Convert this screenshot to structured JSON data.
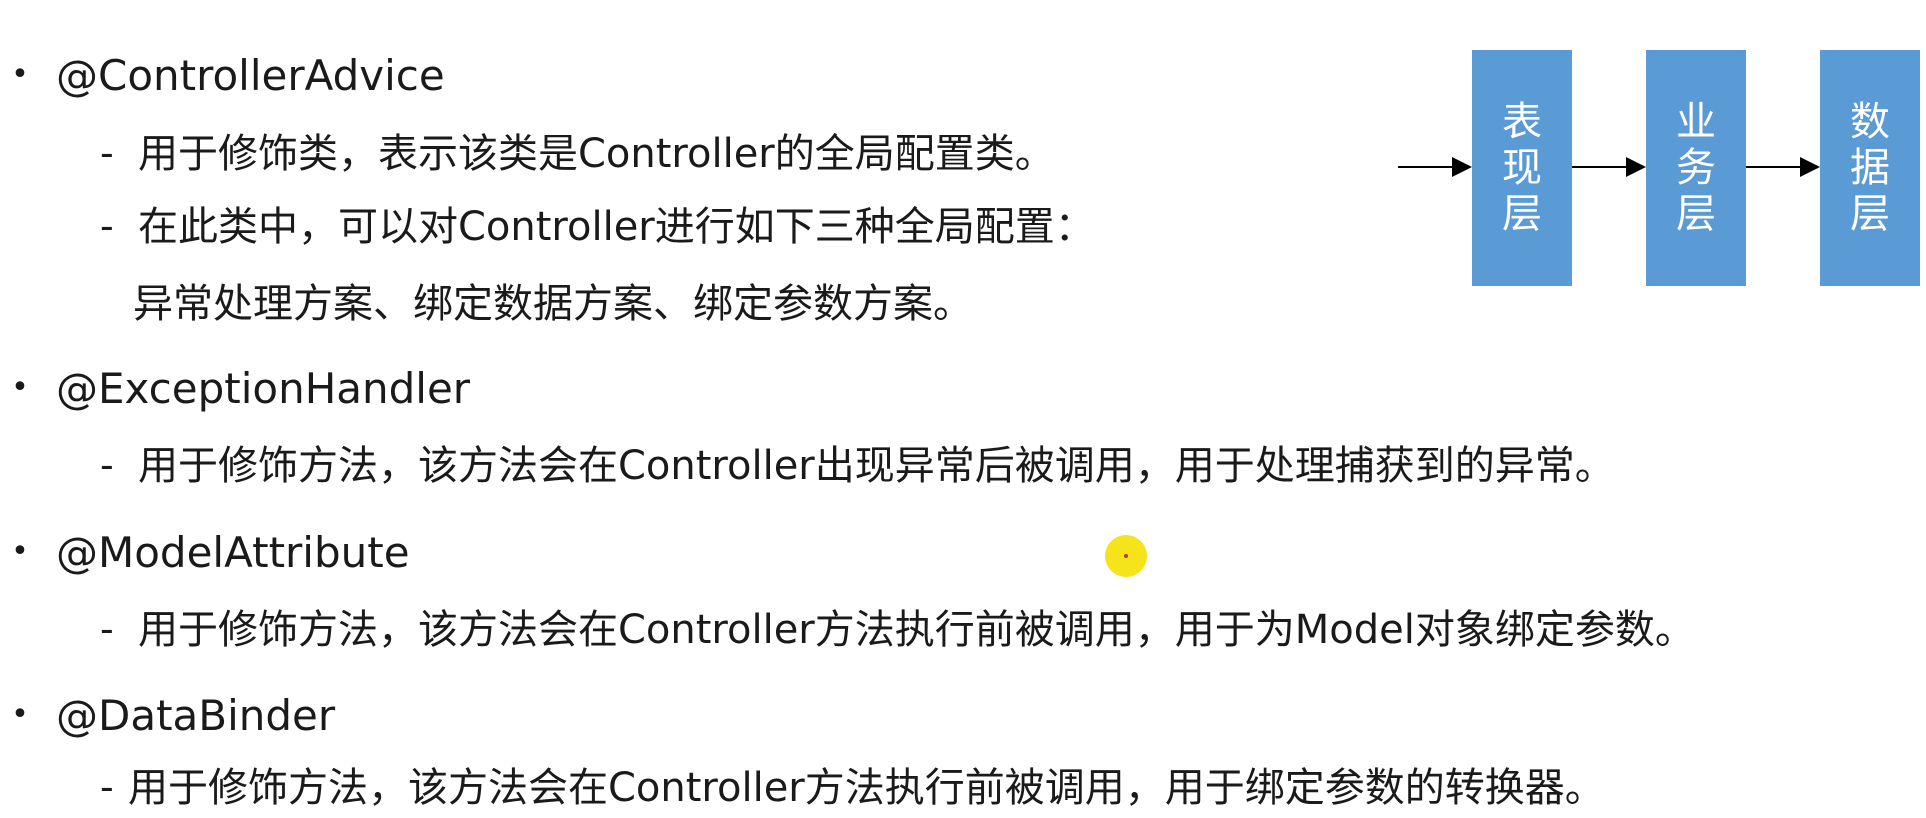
{
  "sections": [
    {
      "heading": "@ControllerAdvice",
      "lines": [
        "用于修饰类，表示该类是Controller的全局配置类。",
        "在此类中，可以对Controller进行如下三种全局配置："
      ],
      "continuation": "异常处理方案、绑定数据方案、绑定参数方案。"
    },
    {
      "heading": "@ExceptionHandler",
      "lines": [
        "用于修饰方法，该方法会在Controller出现异常后被调用，用于处理捕获到的异常。"
      ]
    },
    {
      "heading": "@ModelAttribute",
      "lines": [
        "用于修饰方法，该方法会在Controller方法执行前被调用，用于为Model对象绑定参数。"
      ]
    },
    {
      "heading": "@DataBinder",
      "lines": [
        "用于修饰方法，该方法会在Controller方法执行前被调用，用于绑定参数的转换器。"
      ]
    }
  ],
  "bullet_symbol": "•",
  "dash_symbol": "-",
  "diagram": {
    "boxes": [
      {
        "chars": [
          "表",
          "现",
          "层"
        ]
      },
      {
        "chars": [
          "业",
          "务",
          "层"
        ]
      },
      {
        "chars": [
          "数",
          "据",
          "层"
        ]
      }
    ],
    "box_color": "#5b9bd5",
    "arrow_color": "#000000"
  },
  "cursor_highlight_color": "#f6e41a"
}
